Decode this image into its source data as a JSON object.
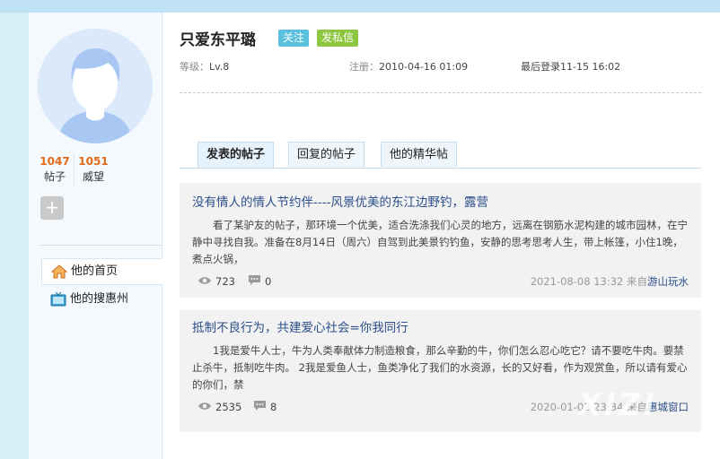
{
  "profile": {
    "name": "只爱东平璐",
    "follow_label": "关注",
    "message_label": "发私信",
    "level_key": "等级：",
    "level_value": "Lv.8",
    "register_key": "注册：",
    "register_value": "2010-04-16 01:09",
    "lastlogin_key": "最后登录",
    "lastlogin_value": "11-15 16:02"
  },
  "stats": [
    {
      "num": "1047",
      "label": "帖子"
    },
    {
      "num": "1051",
      "label": "威望"
    }
  ],
  "plus_label": "+",
  "nav": [
    {
      "label": "他的首页",
      "icon": "home-icon"
    },
    {
      "label": "他的搜惠州",
      "icon": "tv-icon"
    }
  ],
  "tabs": [
    {
      "label": "发表的帖子"
    },
    {
      "label": "回复的帖子"
    },
    {
      "label": "他的精华帖"
    }
  ],
  "posts": [
    {
      "title": "没有情人的情人节约伴----风景优美的东江边野钓，露营",
      "body": "看了某驴友的帖子，那环境一个优美，适合洗涤我们心灵的地方，远离在钢筋水泥构建的城市园林，在宁静中寻找自我。准备在8月14日（周六）自驾到此美景钓钓鱼，安静的思考思考人生，带上帐篷，小住1晚，煮点火锅，",
      "views": "723",
      "comments": "0",
      "time": "2021-08-08 13:32 来自",
      "source": "游山玩水"
    },
    {
      "title": "抵制不良行为，共建爱心社会=你我同行",
      "body": "1我是爱牛人士，牛为人类奉献体力制造粮食，那么辛勤的牛，你们怎么忍心吃它？请不要吃牛肉。要禁止杀牛，抵制吃牛肉。 2我是爱鱼人士，鱼类净化了我们的水资源，长的又好看，作为观赏鱼，所以请有爱心的你们，禁",
      "views": "2535",
      "comments": "8",
      "time": "2020-01-02 23:34 来自",
      "source": "惠城窗口"
    }
  ],
  "watermark": "XIZI",
  "colors": {
    "accent": "#2b4f8a",
    "stat_number": "#e36a1a",
    "follow": "#5bc0de",
    "message": "#8dc63f"
  }
}
